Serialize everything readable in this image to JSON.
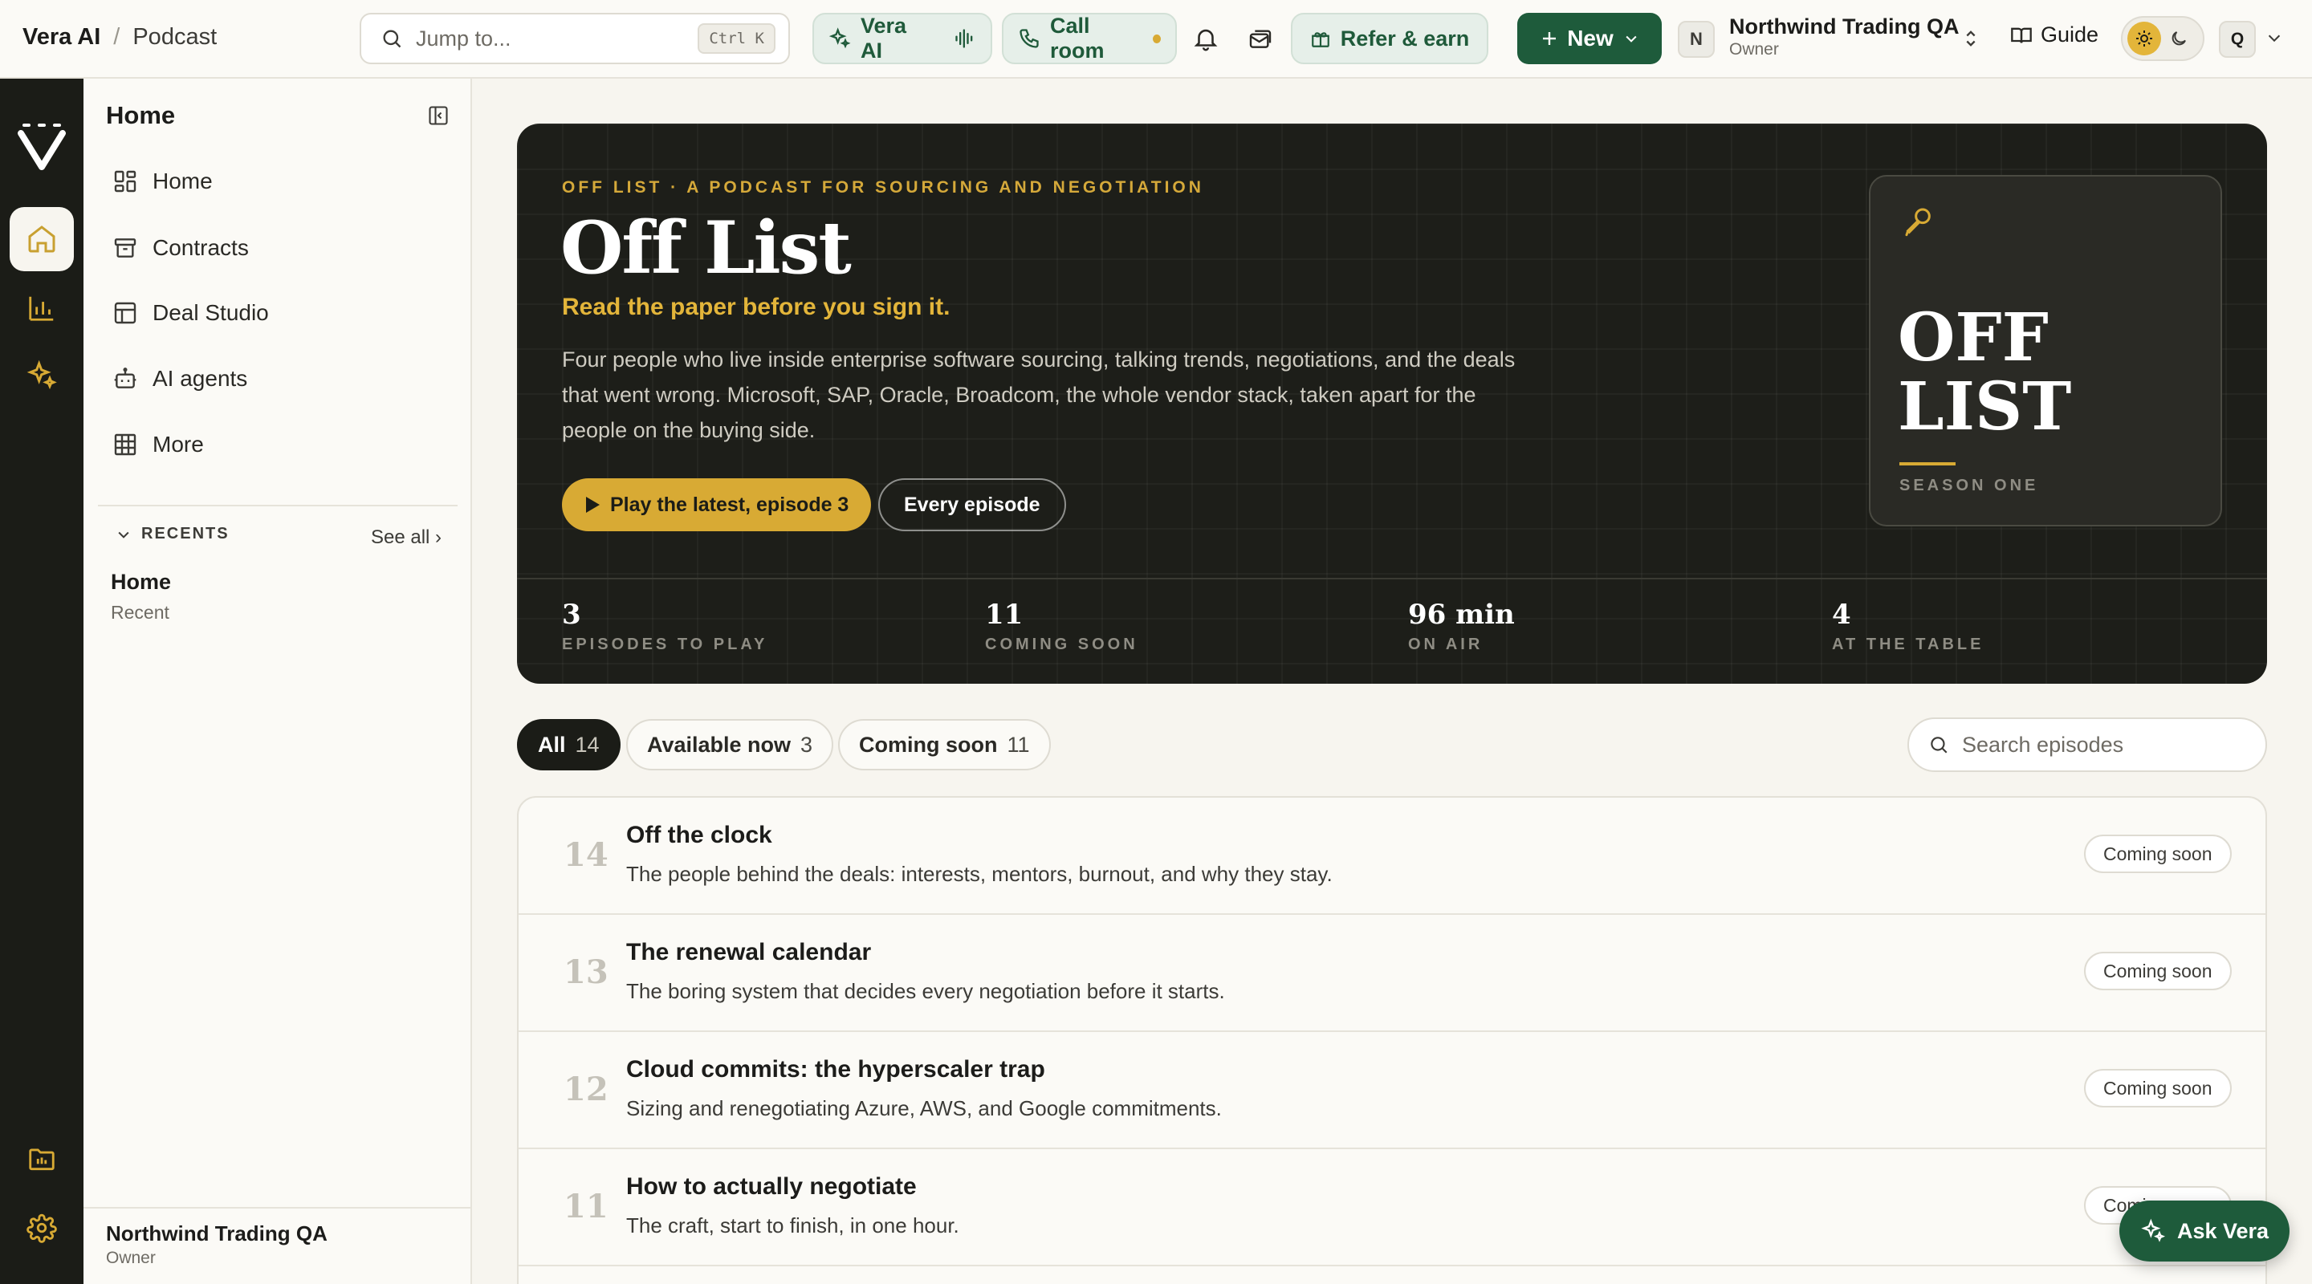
{
  "breadcrumb": {
    "app": "Vera AI",
    "separator": "/",
    "page": "Podcast"
  },
  "topbar": {
    "jump_placeholder": "Jump to...",
    "jump_shortcut": "Ctrl K",
    "vera_ai_label": "Vera AI",
    "call_room_label": "Call room",
    "refer_label": "Refer & earn",
    "new_label": "New",
    "org_initial": "N",
    "org_name": "Northwind Trading QA",
    "org_role": "Owner",
    "guide_label": "Guide",
    "user_initial": "Q"
  },
  "sidebar": {
    "title": "Home",
    "items": [
      {
        "label": "Home",
        "icon": "dashboard-icon"
      },
      {
        "label": "Contracts",
        "icon": "archive-icon"
      },
      {
        "label": "Deal Studio",
        "icon": "layout-icon"
      },
      {
        "label": "AI agents",
        "icon": "bot-icon"
      },
      {
        "label": "More",
        "icon": "grid-icon"
      }
    ],
    "recents_label": "RECENTS",
    "see_all": "See all ›",
    "recent": {
      "title": "Home",
      "subtitle": "Recent"
    },
    "footer": {
      "org": "Northwind Trading QA",
      "role": "Owner"
    }
  },
  "hero": {
    "eyebrow": "OFF LIST · A PODCAST FOR SOURCING AND NEGOTIATION",
    "title": "Off List",
    "tagline": "Read the paper before you sign it.",
    "description": "Four people who live inside enterprise software sourcing, talking trends, negotiations, and the deals that went wrong. Microsoft, SAP, Oracle, Broadcom, the whole vendor stack, taken apart for the people on the buying side.",
    "play_label": "Play the latest, episode 3",
    "every_label": "Every episode",
    "cover_title_line1": "OFF",
    "cover_title_line2": "LIST",
    "cover_subtitle": "SEASON ONE",
    "stats": [
      {
        "value": "3",
        "label": "EPISODES TO PLAY"
      },
      {
        "value": "11",
        "label": "COMING SOON"
      },
      {
        "value": "96 min",
        "label": "ON AIR"
      },
      {
        "value": "4",
        "label": "AT THE TABLE"
      }
    ]
  },
  "filters": [
    {
      "label": "All",
      "count": "14",
      "active": true
    },
    {
      "label": "Available now",
      "count": "3",
      "active": false
    },
    {
      "label": "Coming soon",
      "count": "11",
      "active": false
    }
  ],
  "episode_search_placeholder": "Search episodes",
  "episodes": [
    {
      "number": "14",
      "title": "Off the clock",
      "description": "The people behind the deals: interests, mentors, burnout, and why they stay.",
      "status": "Coming soon"
    },
    {
      "number": "13",
      "title": "The renewal calendar",
      "description": "The boring system that decides every negotiation before it starts.",
      "status": "Coming soon"
    },
    {
      "number": "12",
      "title": "Cloud commits: the hyperscaler trap",
      "description": "Sizing and renegotiating Azure, AWS, and Google commitments.",
      "status": "Coming soon"
    },
    {
      "number": "11",
      "title": "How to actually negotiate",
      "description": "The craft, start to finish, in one hour.",
      "status": "Coming soon"
    }
  ],
  "ask_vera_label": "Ask Vera",
  "colors": {
    "accent_green": "#1e5b3b",
    "gold": "#d8aa34",
    "hero_bg": "#1d1e19",
    "rail_bg": "#1b1c17"
  }
}
